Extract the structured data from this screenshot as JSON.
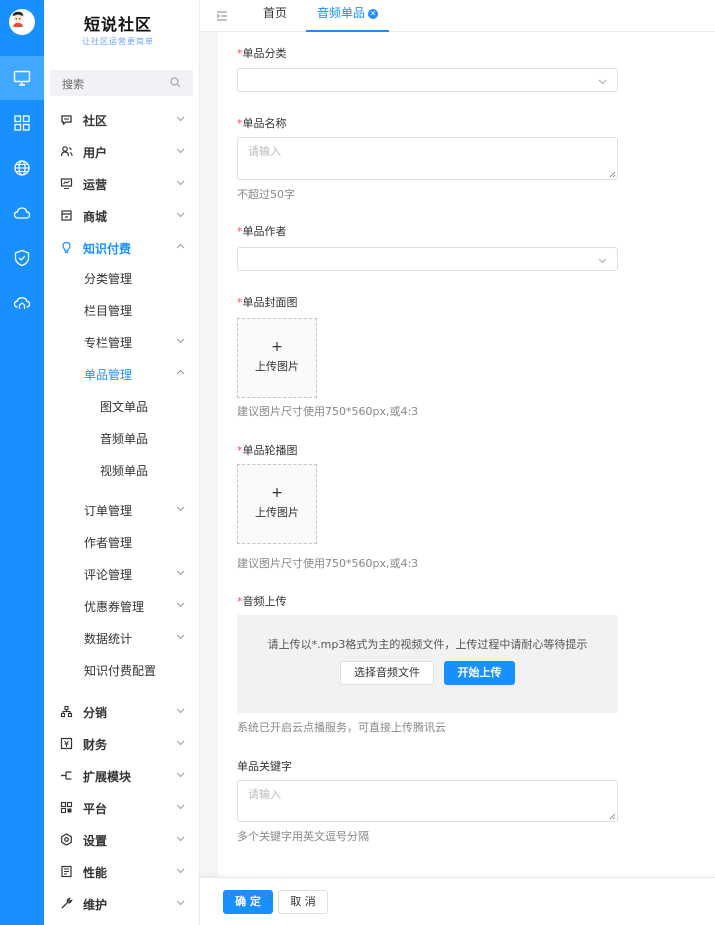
{
  "brand": {
    "title": "短说社区",
    "subtitle": "让社区运营更简单"
  },
  "colors": {
    "primary": "#1890ff",
    "required": "#ff4d4f"
  },
  "rail": {
    "icons": [
      "monitor-icon",
      "grid-icon",
      "globe-icon",
      "cloud-icon",
      "shield-check-icon",
      "cloud-home-icon"
    ]
  },
  "sidebar": {
    "search_placeholder": "搜索",
    "items": [
      {
        "label": "社区",
        "icon": "chat-icon"
      },
      {
        "label": "用户",
        "icon": "users-icon"
      },
      {
        "label": "运营",
        "icon": "monitor-chart-icon"
      },
      {
        "label": "商城",
        "icon": "store-icon"
      },
      {
        "label": "知识付费",
        "icon": "bulb-icon"
      },
      {
        "label": "分销",
        "icon": "hierarchy-icon"
      },
      {
        "label": "财务",
        "icon": "finance-icon"
      },
      {
        "label": "扩展模块",
        "icon": "extend-icon"
      },
      {
        "label": "平台",
        "icon": "platform-icon"
      },
      {
        "label": "设置",
        "icon": "settings-icon"
      },
      {
        "label": "性能",
        "icon": "performance-icon"
      },
      {
        "label": "维护",
        "icon": "wrench-icon"
      }
    ],
    "sub": {
      "category": "分类管理",
      "column": "栏目管理",
      "special": "专栏管理",
      "single": "单品管理",
      "single_text": "图文单品",
      "single_audio": "音频单品",
      "single_video": "视频单品",
      "order": "订单管理",
      "author": "作者管理",
      "comment": "评论管理",
      "coupon": "优惠券管理",
      "stats": "数据统计",
      "config": "知识付费配置"
    }
  },
  "tabs": [
    {
      "label": "首页"
    },
    {
      "label": "音频单品"
    }
  ],
  "form": {
    "required_mark": "*",
    "category": {
      "label": "单品分类"
    },
    "name": {
      "label": "单品名称",
      "placeholder": "请输入",
      "hint": "不超过50字"
    },
    "author": {
      "label": "单品作者"
    },
    "cover": {
      "label": "单品封面图",
      "plus": "+",
      "upload_text": "上传图片",
      "hint": "建议图片尺寸使用750*560px,或4:3"
    },
    "carousel": {
      "label": "单品轮播图",
      "plus": "+",
      "upload_text": "上传图片",
      "hint": "建议图片尺寸使用750*560px,或4:3"
    },
    "audio": {
      "label": "音频上传",
      "message": "请上传以*.mp3格式为主的视频文件，上传过程中请耐心等待提示",
      "select_button": "选择音频文件",
      "start_button": "开始上传",
      "hint": "系统已开启云点播服务，可直接上传腾讯云"
    },
    "keywords": {
      "label": "单品关键字",
      "placeholder": "请输入",
      "hint": "多个关键字用英文逗号分隔"
    }
  },
  "footer": {
    "confirm": "确 定",
    "cancel": "取 消"
  }
}
